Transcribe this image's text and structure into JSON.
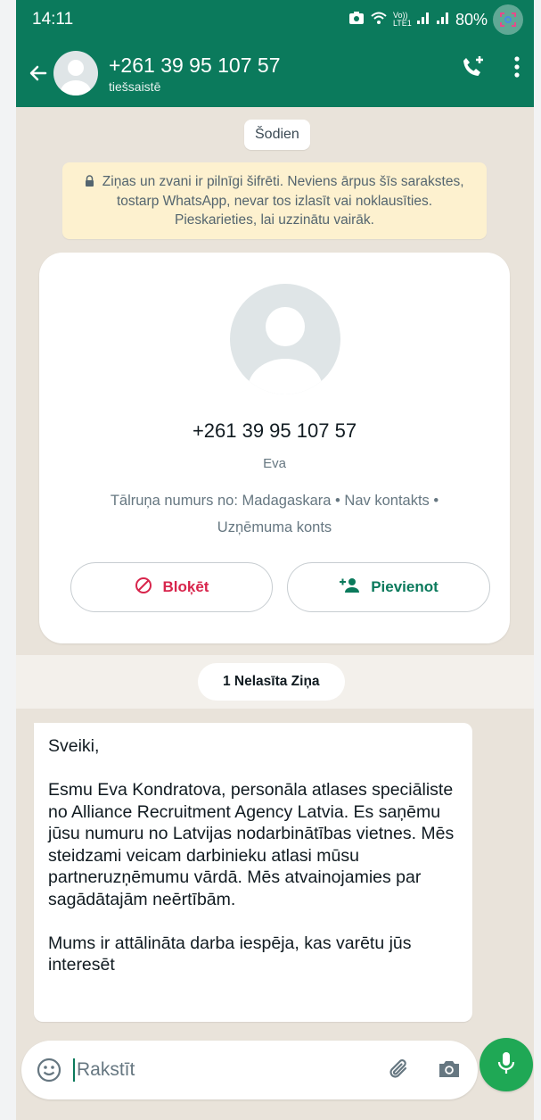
{
  "status_bar": {
    "time": "14:11",
    "network_label": "Vo)) LTE1",
    "battery": "80%"
  },
  "header": {
    "title": "+261 39 95 107 57",
    "subtitle": "tiešsaistē"
  },
  "chat": {
    "date_label": "Šodien",
    "encryption_notice": "Ziņas un zvani ir pilnīgi šifrēti. Neviens ārpus šīs sarakstes, tostarp WhatsApp, nevar tos izlasīt vai noklausīties. Pieskarieties, lai uzzinātu vairāk.",
    "contact_card": {
      "phone": "+261 39 95 107 57",
      "name": "Eva",
      "info": "Tālruņa numurs no: Madagaskara • Nav kontakts • Uzņēmuma konts",
      "block_label": "Bloķēt",
      "add_label": "Pievienot"
    },
    "unread_label": "1 Nelasīta Ziņa",
    "message": "Sveiki,\n\nEsmu Eva Kondratova, personāla atlases speciāliste no Alliance Recruitment Agency Latvia. Es saņēmu jūsu numuru no Latvijas nodarbinātības vietnes. Mēs steidzami veicam darbinieku atlasi mūsu partneruzņēmumu vārdā. Mēs atvainojamies par sagādātajām neērtībām.\n\nMums ir attālināta darba iespēja, kas varētu jūs interesēt"
  },
  "composer": {
    "placeholder": "Rakstīt"
  },
  "colors": {
    "header": "#0b7a5c",
    "chat_background": "#e9e3da",
    "notice": "#fdf1cf",
    "block_red": "#d8254c",
    "mic_green": "#1fa855"
  },
  "icons": [
    "back-arrow-icon",
    "avatar-icon",
    "add-call-icon",
    "more-vertical-icon",
    "lock-icon",
    "block-icon",
    "add-person-icon",
    "emoji-icon",
    "attach-icon",
    "camera-icon",
    "mic-icon",
    "lens-icon",
    "wifi-icon",
    "signal-icon"
  ]
}
